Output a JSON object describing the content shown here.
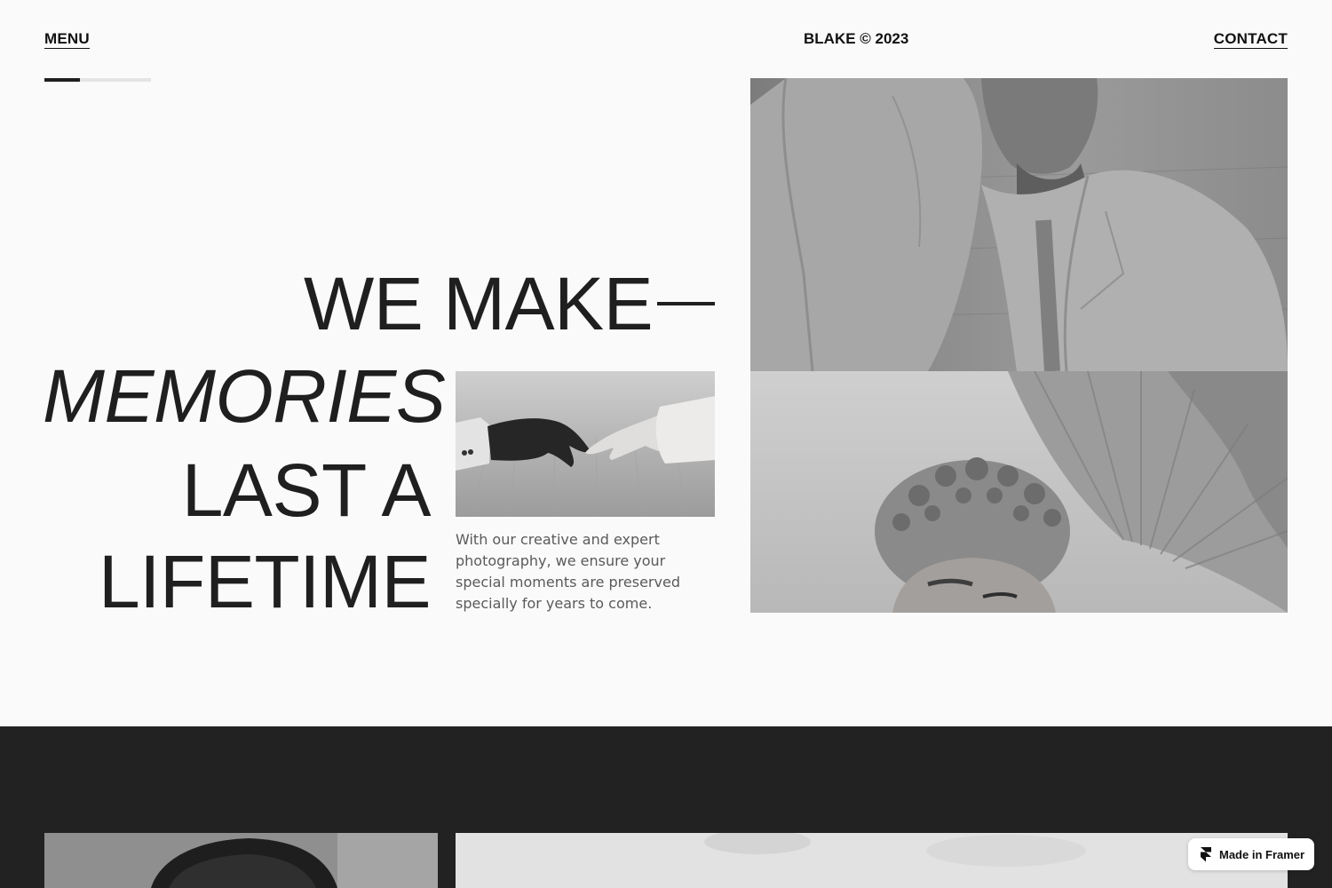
{
  "header": {
    "menu_label": "MENU",
    "brand": "BLAKE © 2023",
    "contact_label": "CONTACT"
  },
  "slider": {
    "progress": 0.33
  },
  "hero": {
    "line_1": "WE MAKE",
    "line_2": "MEMORIES",
    "line_3": "LAST A",
    "line_4": "LIFETIME",
    "description": "With our creative and expert photography, we ensure your special moments are preserved specially for years to come."
  },
  "badge": {
    "label": "Made in Framer",
    "icon": "framer-logo-icon"
  },
  "colors": {
    "background": "#fafafa",
    "text": "#1f1f1f",
    "dark_section": "#222222",
    "muted_text": "#5a5a5a"
  }
}
